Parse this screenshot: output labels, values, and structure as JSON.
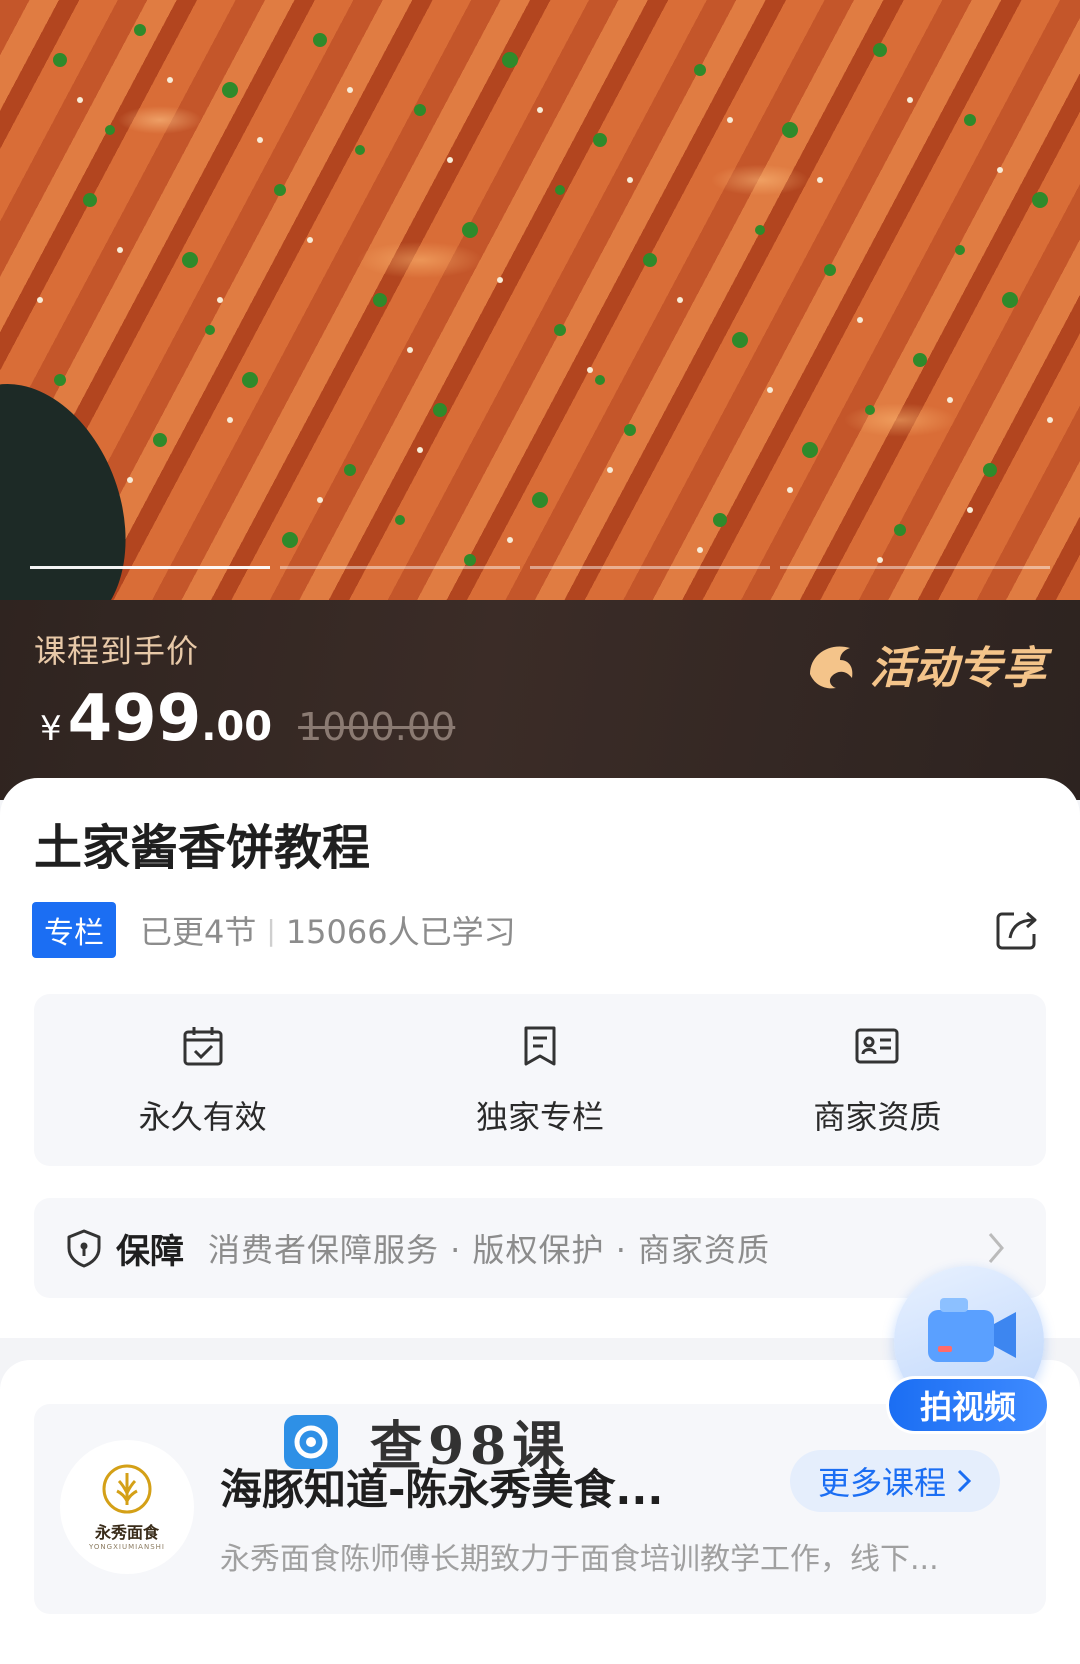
{
  "price": {
    "label": "课程到手价",
    "currency": "¥",
    "amount_int": "499",
    "amount_dec": ".00",
    "original": "1000.00",
    "promo_text": "活动专享"
  },
  "course": {
    "title": "土家酱香饼教程",
    "badge": "专栏",
    "updated": "已更4节",
    "separator": "|",
    "learners": "15066人已学习"
  },
  "features": [
    {
      "label": "永久有效",
      "icon": "calendar-check-icon"
    },
    {
      "label": "独家专栏",
      "icon": "bookmark-doc-icon"
    },
    {
      "label": "商家资质",
      "icon": "id-card-icon"
    }
  ],
  "guarantee": {
    "title": "保障",
    "items": "消费者保障服务 · 版权保护 · 商家资质"
  },
  "shop": {
    "name": "海豚知道-陈永秀美食...",
    "description": "永秀面食陈师傅长期致力于面食培训教学工作，线下...",
    "more_label": "更多课程",
    "logo_cn": "永秀面食",
    "logo_en": "YONGXIUMIANSHI"
  },
  "float_button": {
    "label": "拍视频"
  },
  "watermark": {
    "text": "查98课"
  },
  "colors": {
    "accent": "#1b6ef3",
    "price_banner_bg": "#2f2420",
    "promo_gold": "#f4c48a"
  }
}
